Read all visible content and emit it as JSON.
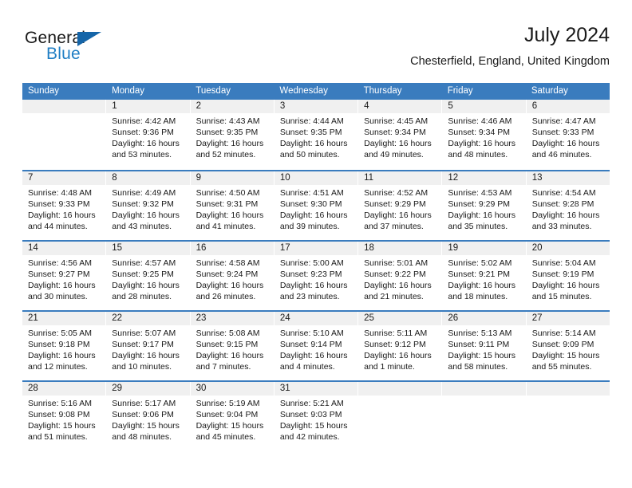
{
  "brand": {
    "name_part1": "General",
    "name_part2": "Blue",
    "triangle_icon": "triangle-icon",
    "color_dark": "#1a1a1a",
    "color_blue": "#1f7ec4"
  },
  "header": {
    "title": "July 2024",
    "subtitle": "Chesterfield, England, United Kingdom"
  },
  "calendar": {
    "header_bg": "#3a7cbe",
    "daynum_bg": "#f0f0f0",
    "weekdays": [
      "Sunday",
      "Monday",
      "Tuesday",
      "Wednesday",
      "Thursday",
      "Friday",
      "Saturday"
    ],
    "weeks": [
      [
        {
          "day": "",
          "sunrise": "",
          "sunset": "",
          "daylight1": "",
          "daylight2": ""
        },
        {
          "day": "1",
          "sunrise": "Sunrise: 4:42 AM",
          "sunset": "Sunset: 9:36 PM",
          "daylight1": "Daylight: 16 hours",
          "daylight2": "and 53 minutes."
        },
        {
          "day": "2",
          "sunrise": "Sunrise: 4:43 AM",
          "sunset": "Sunset: 9:35 PM",
          "daylight1": "Daylight: 16 hours",
          "daylight2": "and 52 minutes."
        },
        {
          "day": "3",
          "sunrise": "Sunrise: 4:44 AM",
          "sunset": "Sunset: 9:35 PM",
          "daylight1": "Daylight: 16 hours",
          "daylight2": "and 50 minutes."
        },
        {
          "day": "4",
          "sunrise": "Sunrise: 4:45 AM",
          "sunset": "Sunset: 9:34 PM",
          "daylight1": "Daylight: 16 hours",
          "daylight2": "and 49 minutes."
        },
        {
          "day": "5",
          "sunrise": "Sunrise: 4:46 AM",
          "sunset": "Sunset: 9:34 PM",
          "daylight1": "Daylight: 16 hours",
          "daylight2": "and 48 minutes."
        },
        {
          "day": "6",
          "sunrise": "Sunrise: 4:47 AM",
          "sunset": "Sunset: 9:33 PM",
          "daylight1": "Daylight: 16 hours",
          "daylight2": "and 46 minutes."
        }
      ],
      [
        {
          "day": "7",
          "sunrise": "Sunrise: 4:48 AM",
          "sunset": "Sunset: 9:33 PM",
          "daylight1": "Daylight: 16 hours",
          "daylight2": "and 44 minutes."
        },
        {
          "day": "8",
          "sunrise": "Sunrise: 4:49 AM",
          "sunset": "Sunset: 9:32 PM",
          "daylight1": "Daylight: 16 hours",
          "daylight2": "and 43 minutes."
        },
        {
          "day": "9",
          "sunrise": "Sunrise: 4:50 AM",
          "sunset": "Sunset: 9:31 PM",
          "daylight1": "Daylight: 16 hours",
          "daylight2": "and 41 minutes."
        },
        {
          "day": "10",
          "sunrise": "Sunrise: 4:51 AM",
          "sunset": "Sunset: 9:30 PM",
          "daylight1": "Daylight: 16 hours",
          "daylight2": "and 39 minutes."
        },
        {
          "day": "11",
          "sunrise": "Sunrise: 4:52 AM",
          "sunset": "Sunset: 9:29 PM",
          "daylight1": "Daylight: 16 hours",
          "daylight2": "and 37 minutes."
        },
        {
          "day": "12",
          "sunrise": "Sunrise: 4:53 AM",
          "sunset": "Sunset: 9:29 PM",
          "daylight1": "Daylight: 16 hours",
          "daylight2": "and 35 minutes."
        },
        {
          "day": "13",
          "sunrise": "Sunrise: 4:54 AM",
          "sunset": "Sunset: 9:28 PM",
          "daylight1": "Daylight: 16 hours",
          "daylight2": "and 33 minutes."
        }
      ],
      [
        {
          "day": "14",
          "sunrise": "Sunrise: 4:56 AM",
          "sunset": "Sunset: 9:27 PM",
          "daylight1": "Daylight: 16 hours",
          "daylight2": "and 30 minutes."
        },
        {
          "day": "15",
          "sunrise": "Sunrise: 4:57 AM",
          "sunset": "Sunset: 9:25 PM",
          "daylight1": "Daylight: 16 hours",
          "daylight2": "and 28 minutes."
        },
        {
          "day": "16",
          "sunrise": "Sunrise: 4:58 AM",
          "sunset": "Sunset: 9:24 PM",
          "daylight1": "Daylight: 16 hours",
          "daylight2": "and 26 minutes."
        },
        {
          "day": "17",
          "sunrise": "Sunrise: 5:00 AM",
          "sunset": "Sunset: 9:23 PM",
          "daylight1": "Daylight: 16 hours",
          "daylight2": "and 23 minutes."
        },
        {
          "day": "18",
          "sunrise": "Sunrise: 5:01 AM",
          "sunset": "Sunset: 9:22 PM",
          "daylight1": "Daylight: 16 hours",
          "daylight2": "and 21 minutes."
        },
        {
          "day": "19",
          "sunrise": "Sunrise: 5:02 AM",
          "sunset": "Sunset: 9:21 PM",
          "daylight1": "Daylight: 16 hours",
          "daylight2": "and 18 minutes."
        },
        {
          "day": "20",
          "sunrise": "Sunrise: 5:04 AM",
          "sunset": "Sunset: 9:19 PM",
          "daylight1": "Daylight: 16 hours",
          "daylight2": "and 15 minutes."
        }
      ],
      [
        {
          "day": "21",
          "sunrise": "Sunrise: 5:05 AM",
          "sunset": "Sunset: 9:18 PM",
          "daylight1": "Daylight: 16 hours",
          "daylight2": "and 12 minutes."
        },
        {
          "day": "22",
          "sunrise": "Sunrise: 5:07 AM",
          "sunset": "Sunset: 9:17 PM",
          "daylight1": "Daylight: 16 hours",
          "daylight2": "and 10 minutes."
        },
        {
          "day": "23",
          "sunrise": "Sunrise: 5:08 AM",
          "sunset": "Sunset: 9:15 PM",
          "daylight1": "Daylight: 16 hours",
          "daylight2": "and 7 minutes."
        },
        {
          "day": "24",
          "sunrise": "Sunrise: 5:10 AM",
          "sunset": "Sunset: 9:14 PM",
          "daylight1": "Daylight: 16 hours",
          "daylight2": "and 4 minutes."
        },
        {
          "day": "25",
          "sunrise": "Sunrise: 5:11 AM",
          "sunset": "Sunset: 9:12 PM",
          "daylight1": "Daylight: 16 hours",
          "daylight2": "and 1 minute."
        },
        {
          "day": "26",
          "sunrise": "Sunrise: 5:13 AM",
          "sunset": "Sunset: 9:11 PM",
          "daylight1": "Daylight: 15 hours",
          "daylight2": "and 58 minutes."
        },
        {
          "day": "27",
          "sunrise": "Sunrise: 5:14 AM",
          "sunset": "Sunset: 9:09 PM",
          "daylight1": "Daylight: 15 hours",
          "daylight2": "and 55 minutes."
        }
      ],
      [
        {
          "day": "28",
          "sunrise": "Sunrise: 5:16 AM",
          "sunset": "Sunset: 9:08 PM",
          "daylight1": "Daylight: 15 hours",
          "daylight2": "and 51 minutes."
        },
        {
          "day": "29",
          "sunrise": "Sunrise: 5:17 AM",
          "sunset": "Sunset: 9:06 PM",
          "daylight1": "Daylight: 15 hours",
          "daylight2": "and 48 minutes."
        },
        {
          "day": "30",
          "sunrise": "Sunrise: 5:19 AM",
          "sunset": "Sunset: 9:04 PM",
          "daylight1": "Daylight: 15 hours",
          "daylight2": "and 45 minutes."
        },
        {
          "day": "31",
          "sunrise": "Sunrise: 5:21 AM",
          "sunset": "Sunset: 9:03 PM",
          "daylight1": "Daylight: 15 hours",
          "daylight2": "and 42 minutes."
        },
        {
          "day": "",
          "sunrise": "",
          "sunset": "",
          "daylight1": "",
          "daylight2": ""
        },
        {
          "day": "",
          "sunrise": "",
          "sunset": "",
          "daylight1": "",
          "daylight2": ""
        },
        {
          "day": "",
          "sunrise": "",
          "sunset": "",
          "daylight1": "",
          "daylight2": ""
        }
      ]
    ]
  }
}
